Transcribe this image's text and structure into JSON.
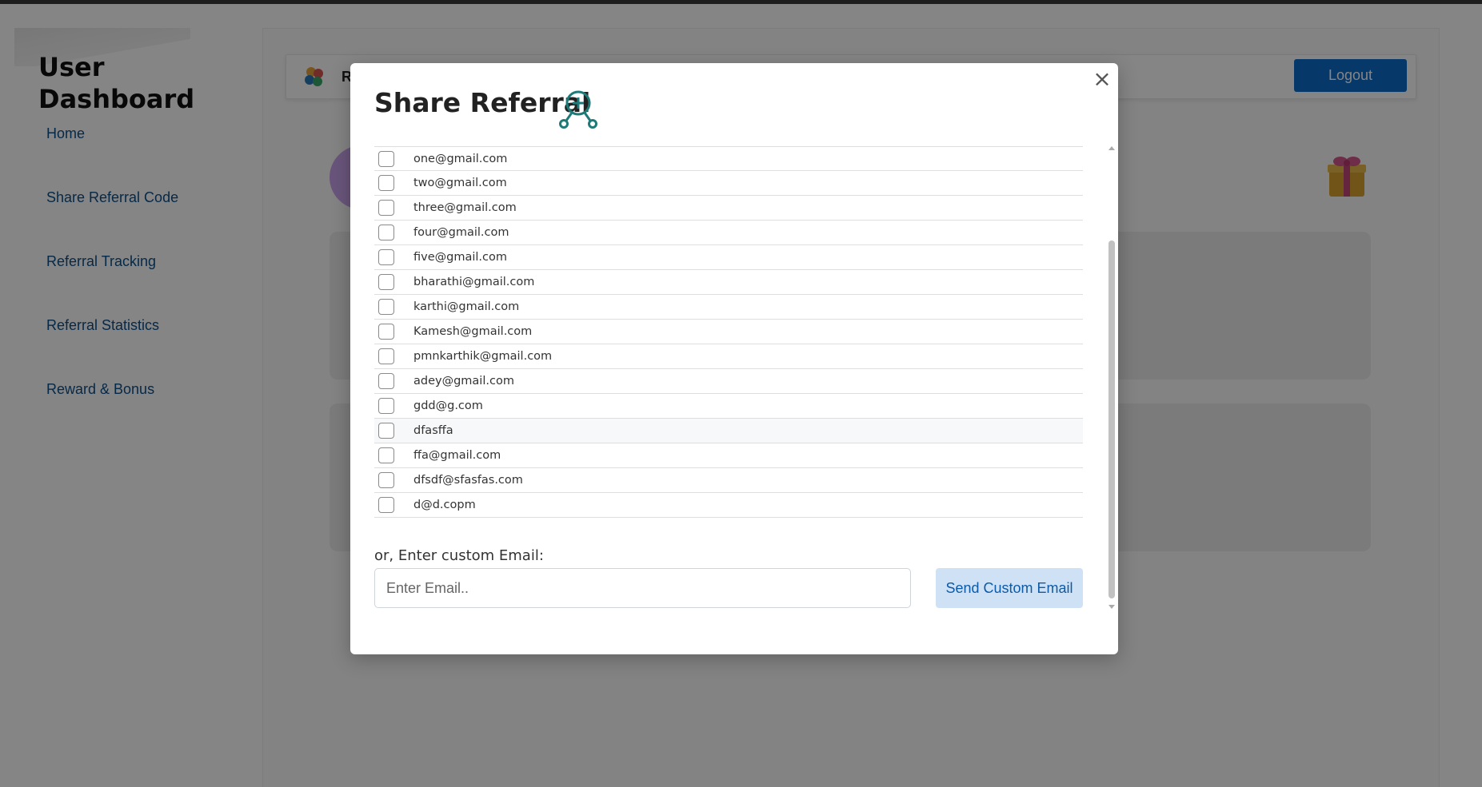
{
  "sidebar": {
    "title": "User Dashboard",
    "items": [
      {
        "label": "Home"
      },
      {
        "label": "Share Referral Code"
      },
      {
        "label": "Referral Tracking"
      },
      {
        "label": "Referral Statistics"
      },
      {
        "label": "Reward & Bonus"
      }
    ]
  },
  "header": {
    "brand_text": "R",
    "logout_label": "Logout"
  },
  "modal": {
    "title": "Share Referral",
    "close_label": "×",
    "emails": [
      "one@gmail.com",
      "two@gmail.com",
      "three@gmail.com",
      "four@gmail.com",
      "five@gmail.com",
      "bharathi@gmail.com",
      "karthi@gmail.com",
      "Kamesh@gmail.com",
      "pmnkarthik@gmail.com",
      "adey@gmail.com",
      "gdd@g.com",
      "dfasffa",
      "ffa@gmail.com",
      "dfsdf@sfasfas.com",
      "d@d.copm"
    ],
    "custom_label": "or, Enter custom Email:",
    "input_placeholder": "Enter Email..",
    "input_value": "",
    "send_label": "Send Custom Email"
  },
  "colors": {
    "accent": "#0d6bc9",
    "link": "#0d4f8b",
    "icon_teal": "#1e7a78"
  },
  "icons": {
    "share": "share-referral-icon",
    "close": "close-icon",
    "logo": "brand-logo-icon",
    "gift": "gift-icon"
  }
}
